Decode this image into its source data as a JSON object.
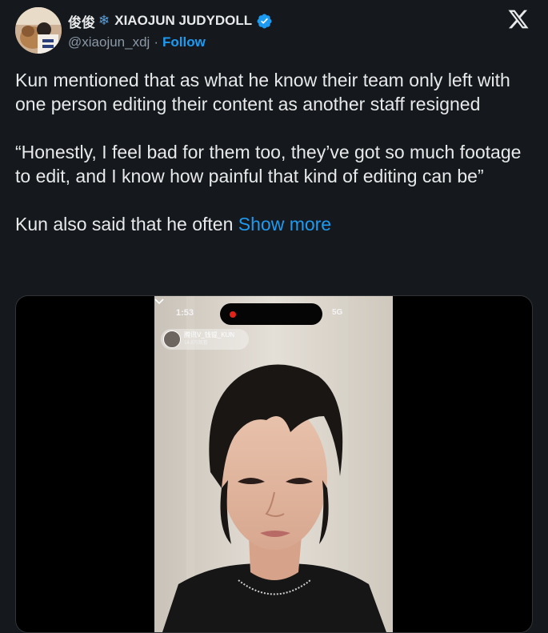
{
  "author": {
    "display_name": "俊俊",
    "display_name_suffix": "XIAOJUN JUDYDOLL",
    "snowflake_icon": "snowflake-icon",
    "verified_icon": "verified-badge-icon",
    "handle": "@xiaojun_xdj",
    "separator": "·",
    "follow_label": "Follow"
  },
  "brand_icon": "x-logo-icon",
  "tweet": {
    "paragraphs": [
      "Kun mentioned that as what he know their team only left with one person editing their content as another staff resigned",
      "“Honestly, I feel bad for them too, they’ve got so much footage to edit, and I know how painful that kind of editing can be”"
    ],
    "truncated_text": "Kun also said that he often ",
    "show_more_label": "Show more"
  },
  "media": {
    "status_time": "1:53",
    "status_right": "5G",
    "live_name": "腾讯V_钱锟_KUN",
    "live_sub": "14.8万观看"
  },
  "colors": {
    "background": "#15181c",
    "text": "#e7e9ea",
    "secondary": "#8b98a5",
    "accent": "#1d9bf0"
  }
}
